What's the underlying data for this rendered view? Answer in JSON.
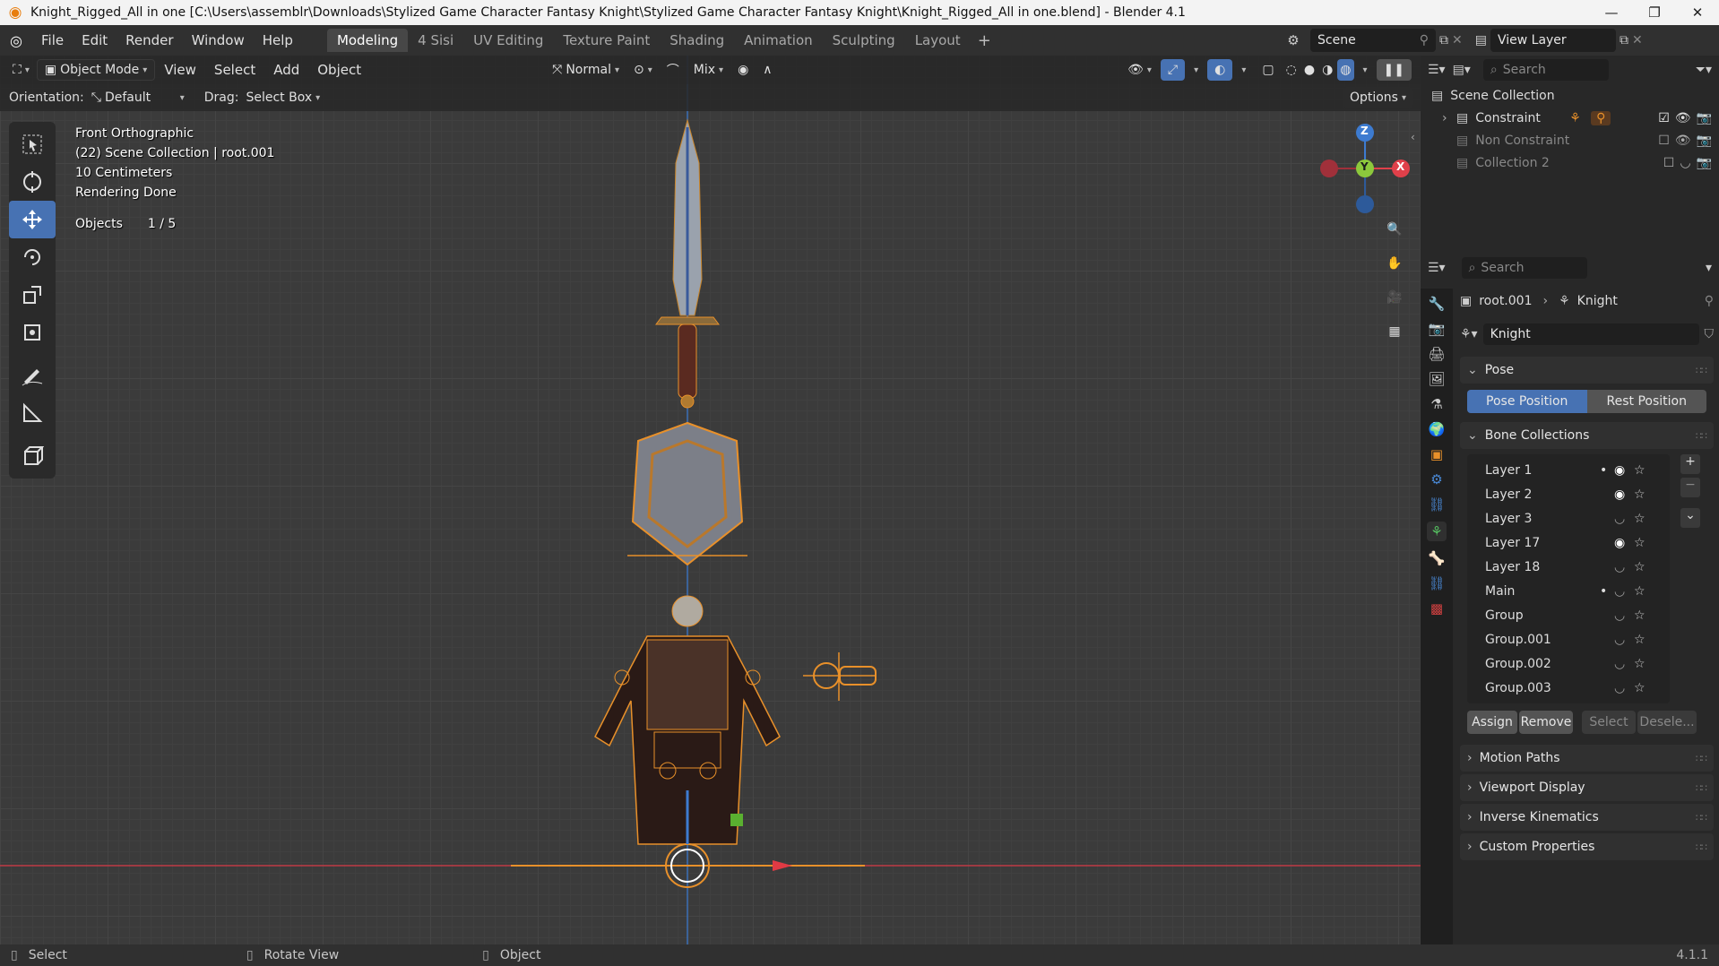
{
  "window": {
    "title": "Knight_Rigged_All in one [C:\\Users\\assemblr\\Downloads\\Stylized Game Character Fantasy Knight\\Stylized Game Character Fantasy Knight\\Knight_Rigged_All in one.blend] - Blender 4.1"
  },
  "menu": [
    "File",
    "Edit",
    "Render",
    "Window",
    "Help"
  ],
  "workspaces": [
    {
      "label": "Modeling",
      "active": true
    },
    {
      "label": "4 Sisi",
      "active": false
    },
    {
      "label": "UV Editing",
      "active": false
    },
    {
      "label": "Texture Paint",
      "active": false
    },
    {
      "label": "Shading",
      "active": false
    },
    {
      "label": "Animation",
      "active": false
    },
    {
      "label": "Sculpting",
      "active": false
    },
    {
      "label": "Layout",
      "active": false
    }
  ],
  "scene": {
    "label": "Scene"
  },
  "view_layer": {
    "label": "View Layer"
  },
  "viewport_header": {
    "mode": "Object Mode",
    "menus": [
      "View",
      "Select",
      "Add",
      "Object"
    ],
    "orientation_mode": "Normal",
    "proportional": "Mix"
  },
  "tool_settings": {
    "orientation_label": "Orientation:",
    "orientation_value": "Default",
    "drag_label": "Drag:",
    "drag_value": "Select Box",
    "options": "Options"
  },
  "viewport_info": {
    "view": "Front Orthographic",
    "collection": "(22) Scene Collection | root.001",
    "scale": "10 Centimeters",
    "status": "Rendering Done",
    "objects_label": "Objects",
    "objects_value": "1 / 5"
  },
  "gizmo": {
    "z": "Z",
    "y": "Y",
    "x": "X"
  },
  "outliner": {
    "search_placeholder": "Search",
    "root": "Scene Collection",
    "items": [
      {
        "label": "Constraint",
        "checked": true,
        "visible": true,
        "dim": false
      },
      {
        "label": "Non Constraint",
        "checked": false,
        "visible": true,
        "dim": true
      },
      {
        "label": "Collection 2",
        "checked": false,
        "visible": false,
        "dim": true
      }
    ]
  },
  "properties": {
    "search_placeholder": "Search",
    "breadcrumb_object": "root.001",
    "breadcrumb_data": "Knight",
    "data_name": "Knight",
    "pose_panel": "Pose",
    "pose_position": "Pose Position",
    "rest_position": "Rest Position",
    "bone_collections_panel": "Bone Collections",
    "bone_collections": [
      {
        "name": "Layer 1",
        "dot": true,
        "visible": true
      },
      {
        "name": "Layer 2",
        "dot": false,
        "visible": true
      },
      {
        "name": "Layer 3",
        "dot": false,
        "visible": false
      },
      {
        "name": "Layer 17",
        "dot": false,
        "visible": true
      },
      {
        "name": "Layer 18",
        "dot": false,
        "visible": false
      },
      {
        "name": "Main",
        "dot": true,
        "visible": false
      },
      {
        "name": "Group",
        "dot": false,
        "visible": false
      },
      {
        "name": "Group.001",
        "dot": false,
        "visible": false
      },
      {
        "name": "Group.002",
        "dot": false,
        "visible": false
      },
      {
        "name": "Group.003",
        "dot": false,
        "visible": false
      }
    ],
    "assign": "Assign",
    "remove": "Remove",
    "select": "Select",
    "deselect": "Desele...",
    "closed_panels": [
      "Motion Paths",
      "Viewport Display",
      "Inverse Kinematics",
      "Custom Properties"
    ]
  },
  "statusbar": {
    "select": "Select",
    "rotate": "Rotate View",
    "object": "Object",
    "version": "4.1.1"
  },
  "colors": {
    "accent": "#4772b3",
    "bone": "#e8902a",
    "x_axis": "#e0404a",
    "y_axis": "#8cc83c",
    "z_axis": "#3d7bd0"
  }
}
